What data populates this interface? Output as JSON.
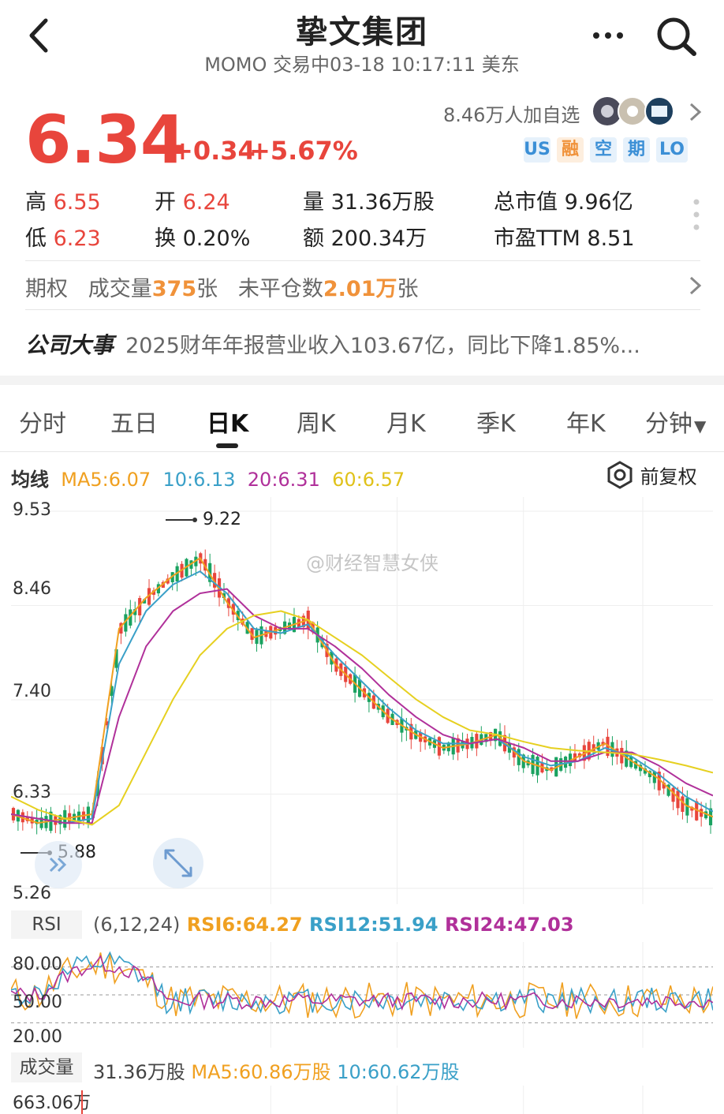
{
  "header": {
    "title": "挚文集团",
    "subtitle": "MOMO 交易中03-18 10:17:11 美东"
  },
  "quote": {
    "price": "6.34",
    "change": "+0.34",
    "change_pct": "+5.67%",
    "followers": "8.46万人加自选",
    "tags": [
      "US",
      "融",
      "空",
      "期",
      "LO"
    ],
    "stats": [
      {
        "label": "高",
        "value": "6.55"
      },
      {
        "label": "开",
        "value": "6.24"
      },
      {
        "label": "量",
        "value": "31.36万股"
      },
      {
        "label": "总市值",
        "value": "9.96亿"
      },
      {
        "label": "低",
        "value": "6.23"
      },
      {
        "label": "换",
        "value": "0.20%"
      },
      {
        "label": "额",
        "value": "200.34万"
      },
      {
        "label": "市盈TTM",
        "value": "8.51"
      }
    ]
  },
  "options": {
    "label": "期权",
    "volume_label": "成交量",
    "volume_value": "375",
    "volume_unit": "张",
    "oi_label": "未平仓数",
    "oi_value": "2.01万",
    "oi_unit": "张"
  },
  "events": {
    "label": "公司大事",
    "text": "2025财年年报营业收入103.67亿，同比下降1.85%..."
  },
  "tabs": [
    "分时",
    "五日",
    "日K",
    "周K",
    "月K",
    "季K",
    "年K",
    "分钟"
  ],
  "ma": {
    "label": "均线",
    "ma5": "MA5:6.07",
    "ma10": "10:6.13",
    "ma20": "20:6.31",
    "ma60": "60:6.57",
    "adjust": "前复权"
  },
  "kline": {
    "y_labels": [
      "9.53",
      "8.46",
      "7.40",
      "6.33",
      "5.26"
    ],
    "high_mark": "9.22",
    "low_mark": "5.88",
    "watermark": "@财经智慧女侠"
  },
  "rsi": {
    "label": "RSI",
    "params": "(6,12,24)",
    "rsi6": "RSI6:64.27",
    "rsi12": "RSI12:51.94",
    "rsi24": "RSI24:47.03",
    "levels": [
      "80.00",
      "50.00",
      "20.00"
    ]
  },
  "volume": {
    "label": "成交量",
    "value": "31.36万股",
    "ma5": "MA5:60.86万股",
    "ma10": "10:60.62万股",
    "max": "663.06万"
  },
  "colors": {
    "red": "#e8453c",
    "green": "#1aa260",
    "ma5": "#f0a020",
    "ma10": "#3aa0c8",
    "ma20": "#b0309a",
    "ma60": "#e6d020"
  },
  "chart_data": {
    "type": "line",
    "title": "",
    "ylim": [
      5.26,
      9.53
    ],
    "series": [
      {
        "name": "MA5",
        "values": [
          6.1,
          6.0,
          6.05,
          6.1,
          8.2,
          8.55,
          8.8,
          9.0,
          8.5,
          8.1,
          8.2,
          8.3,
          7.8,
          7.5,
          7.2,
          7.0,
          6.85,
          6.9,
          7.0,
          6.7,
          6.6,
          6.75,
          6.9,
          6.7,
          6.5,
          6.2,
          6.07
        ]
      },
      {
        "name": "10",
        "values": [
          6.1,
          6.05,
          6.0,
          6.05,
          7.8,
          8.4,
          8.7,
          8.85,
          8.6,
          8.2,
          8.15,
          8.25,
          7.9,
          7.6,
          7.3,
          7.05,
          6.9,
          6.9,
          6.95,
          6.75,
          6.65,
          6.7,
          6.85,
          6.75,
          6.55,
          6.3,
          6.13
        ]
      },
      {
        "name": "20",
        "values": [
          6.1,
          6.05,
          6.0,
          6.0,
          7.2,
          8.0,
          8.4,
          8.6,
          8.65,
          8.35,
          8.2,
          8.2,
          8.0,
          7.75,
          7.45,
          7.2,
          7.0,
          6.9,
          6.95,
          6.85,
          6.7,
          6.7,
          6.8,
          6.8,
          6.65,
          6.45,
          6.31
        ]
      },
      {
        "name": "60",
        "values": [
          6.3,
          6.15,
          6.05,
          5.98,
          6.2,
          6.8,
          7.4,
          7.9,
          8.2,
          8.35,
          8.4,
          8.3,
          8.1,
          7.9,
          7.65,
          7.4,
          7.2,
          7.05,
          7.0,
          6.92,
          6.85,
          6.82,
          6.8,
          6.78,
          6.72,
          6.65,
          6.57
        ]
      }
    ]
  }
}
